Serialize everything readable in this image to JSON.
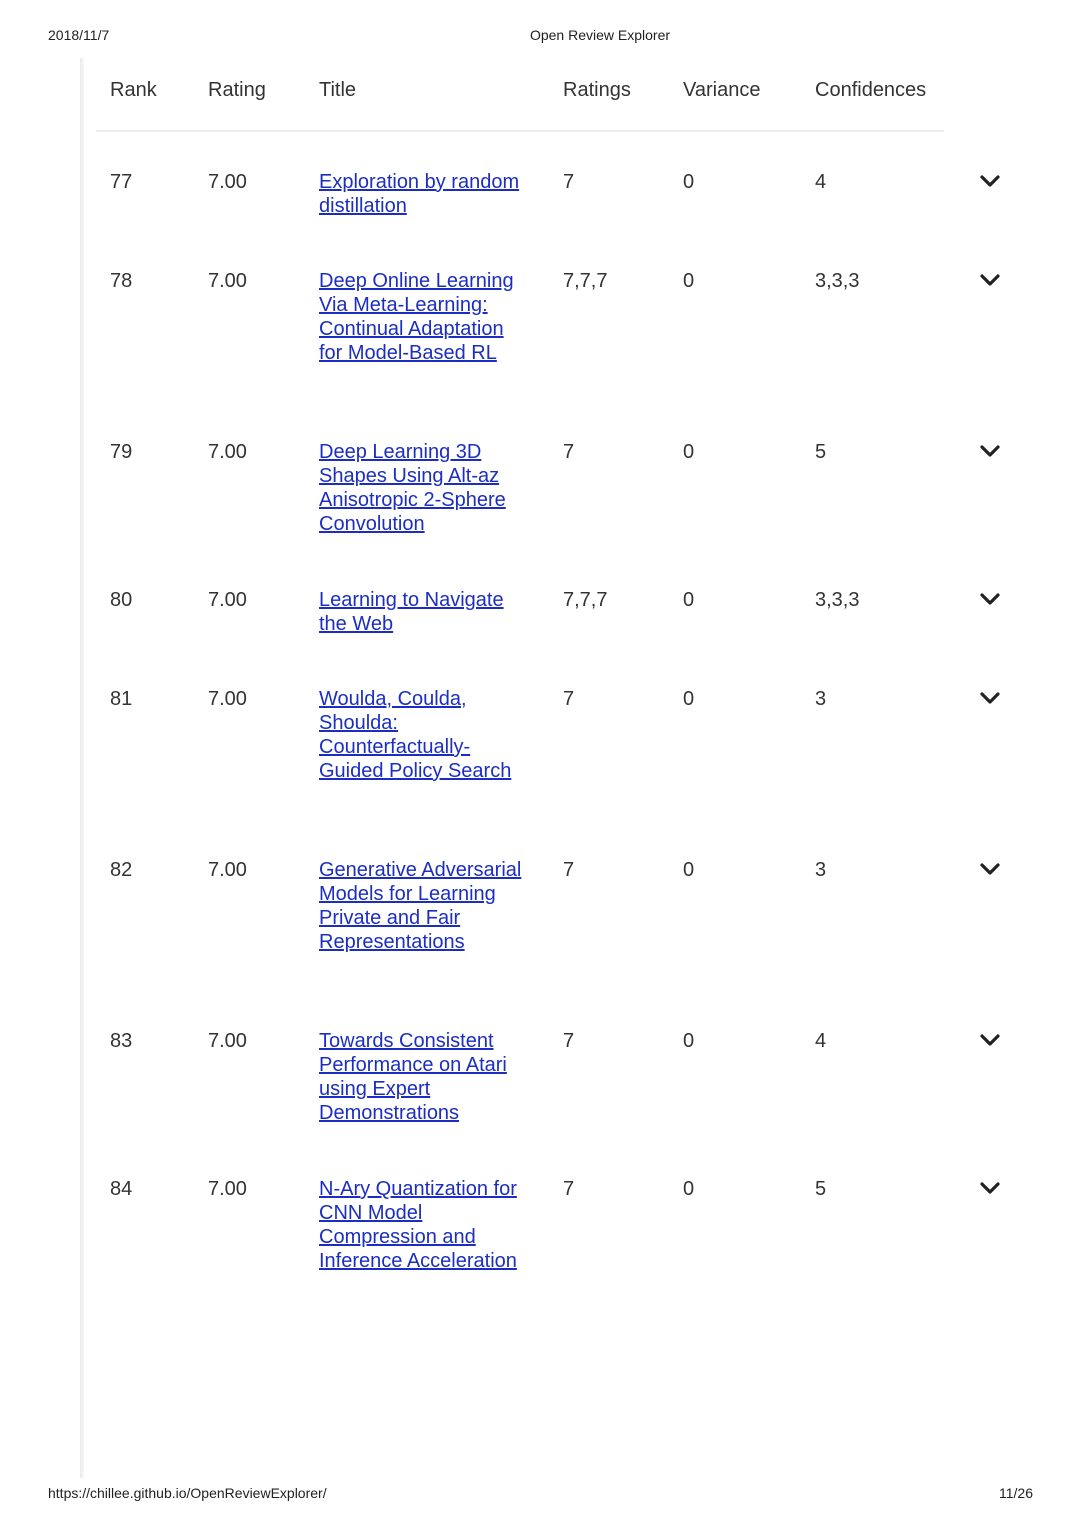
{
  "print_header": {
    "date": "2018/11/7",
    "title": "Open Review Explorer"
  },
  "print_footer": {
    "url": "https://chillee.github.io/OpenReviewExplorer/",
    "page": "11/26"
  },
  "table": {
    "columns": [
      "Rank",
      "Rating",
      "Title",
      "Ratings",
      "Variance",
      "Confidences"
    ],
    "rows": [
      {
        "rank": "77",
        "rating": "7.00",
        "title": "Exploration by random distillation",
        "ratings": "7",
        "variance": "0",
        "confidences": "4"
      },
      {
        "rank": "78",
        "rating": "7.00",
        "title": "Deep Online Learning Via Meta-Learning: Continual Adaptation for Model-Based RL",
        "ratings": "7,7,7",
        "variance": "0",
        "confidences": "3,3,3"
      },
      {
        "rank": "79",
        "rating": "7.00",
        "title": "Deep Learning 3D Shapes Using Alt-az Anisotropic 2-Sphere Convolution",
        "ratings": "7",
        "variance": "0",
        "confidences": "5"
      },
      {
        "rank": "80",
        "rating": "7.00",
        "title": "Learning to Navigate the Web",
        "ratings": "7,7,7",
        "variance": "0",
        "confidences": "3,3,3"
      },
      {
        "rank": "81",
        "rating": "7.00",
        "title": "Woulda, Coulda, Shoulda: Counterfactually-Guided Policy Search",
        "ratings": "7",
        "variance": "0",
        "confidences": "3"
      },
      {
        "rank": "82",
        "rating": "7.00",
        "title": "Generative Adversarial Models for Learning Private and Fair Representations",
        "ratings": "7",
        "variance": "0",
        "confidences": "3"
      },
      {
        "rank": "83",
        "rating": "7.00",
        "title": "Towards Consistent Performance on Atari using Expert Demonstrations",
        "ratings": "7",
        "variance": "0",
        "confidences": "4"
      },
      {
        "rank": "84",
        "rating": "7.00",
        "title": "N-Ary Quantization for CNN Model Compression and Inference Acceleration",
        "ratings": "7",
        "variance": "0",
        "confidences": "5"
      }
    ],
    "expand_icon": "chevron-down-icon"
  },
  "colors": {
    "link": "#1c2ec1",
    "text": "#333333",
    "divider": "#eeeeee"
  }
}
